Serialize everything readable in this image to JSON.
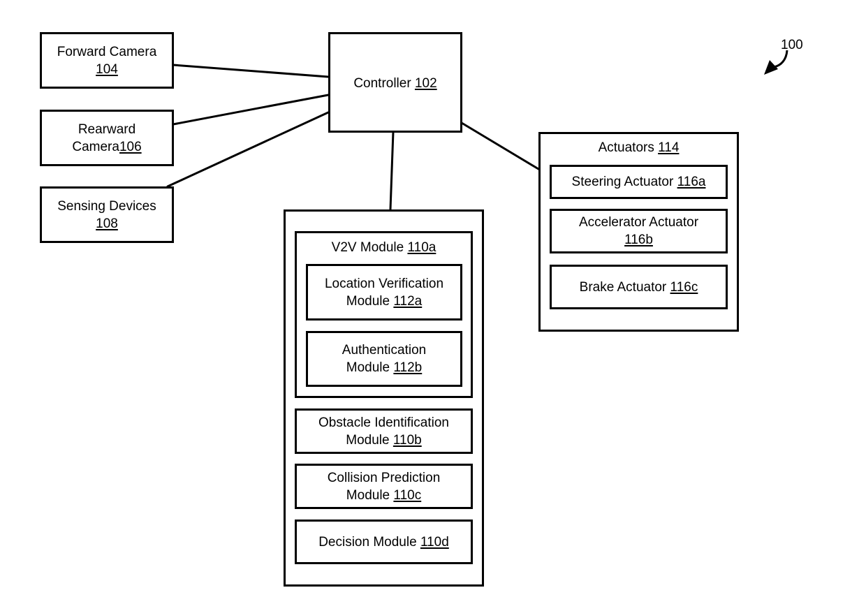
{
  "figure_ref": "100",
  "controller": {
    "label": "Controller",
    "ref": "102"
  },
  "inputs": [
    {
      "line1": "Forward Camera",
      "line2": "",
      "ref": "104"
    },
    {
      "line1": "Rearward",
      "line2": "Camera",
      "ref": "106"
    },
    {
      "line1": "Sensing Devices",
      "line2": "",
      "ref": "108"
    }
  ],
  "modules_group": {
    "v2v": {
      "label": "V2V Module",
      "ref": "110a",
      "children": [
        {
          "line1": "Location Verification",
          "line2": "Module",
          "ref": "112a"
        },
        {
          "line1": "Authentication",
          "line2": "Module",
          "ref": "112b"
        }
      ]
    },
    "modules": [
      {
        "line1": "Obstacle Identification",
        "line2": "Module",
        "ref": "110b"
      },
      {
        "line1": "Collision Prediction",
        "line2": "Module",
        "ref": "110c"
      },
      {
        "line1": "Decision Module",
        "line2": "",
        "ref": "110d"
      }
    ]
  },
  "actuators": {
    "label": "Actuators",
    "ref": "114",
    "items": [
      {
        "line1": "Steering Actuator",
        "line2": "",
        "ref": "116a"
      },
      {
        "line1": "Accelerator Actuator",
        "line2": "",
        "ref": "116b"
      },
      {
        "line1": "Brake Actuator",
        "line2": "",
        "ref": "116c"
      }
    ]
  }
}
